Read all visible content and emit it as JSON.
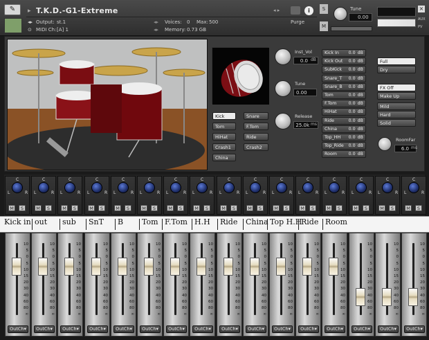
{
  "header": {
    "title": "T.K.D.-G1-Extreme",
    "output_label": "Output:",
    "output_value": "st.1",
    "voices_label": "Voices:",
    "voices_value": "0",
    "max_label": "Max:",
    "max_value": "500",
    "midi_label": "MIDI Ch:",
    "midi_value": "[A]  1",
    "memory_label": "Memory:",
    "memory_value": "0.73 GB",
    "purge_label": "Purge",
    "tune_label": "Tune",
    "tune_value": "0.00",
    "s_label": "S",
    "m_label": "M",
    "aux_label": "AUX",
    "pv_label": "PV"
  },
  "instrument": {
    "inst_vol_label": "Inst_Vol",
    "inst_vol_value": "0.0",
    "inst_vol_unit": "dB",
    "tune_label": "Tune",
    "tune_value": "0.00",
    "release_label": "Release",
    "release_value": "25.0k",
    "release_unit": "ms",
    "roomfar_label": "RoomFar",
    "roomfar_value": "6.0",
    "roomfar_unit": "ms"
  },
  "drum_buttons": [
    "Kick",
    "Snare",
    "Tom",
    "F.Tom",
    "HiHat",
    "Ride",
    "Crash1",
    "Crash2",
    "China"
  ],
  "selected_drum": "Kick",
  "levels": [
    {
      "name": "Kick In",
      "value": "0.0",
      "unit": "dB"
    },
    {
      "name": "Kick Out",
      "value": "0.0",
      "unit": "dB"
    },
    {
      "name": "SubKick",
      "value": "0.0",
      "unit": "dB"
    },
    {
      "name": "Snare_T",
      "value": "0.0",
      "unit": "dB"
    },
    {
      "name": "Snare_B",
      "value": "0.0",
      "unit": "dB"
    },
    {
      "name": "Tom",
      "value": "0.0",
      "unit": "dB"
    },
    {
      "name": "F.Tom",
      "value": "0.0",
      "unit": "dB"
    },
    {
      "name": "HiHat",
      "value": "0.0",
      "unit": "dB"
    },
    {
      "name": "Ride",
      "value": "0.0",
      "unit": "dB"
    },
    {
      "name": "China",
      "value": "0.0",
      "unit": "dB"
    },
    {
      "name": "Top_HH",
      "value": "0.0",
      "unit": "dB"
    },
    {
      "name": "Top_Ride",
      "value": "0.0",
      "unit": "dB"
    },
    {
      "name": "Room",
      "value": "0.0",
      "unit": "dB"
    }
  ],
  "mix_buttons": {
    "full": "Full",
    "dry": "Dry"
  },
  "fx_buttons": {
    "fx_off": "FX Off",
    "make_up": "Make Up",
    "mild": "Mild",
    "hard": "Hard",
    "solid": "Solid"
  },
  "channel_labels": [
    "Kick in",
    "out",
    "sub",
    "SnT",
    "B",
    "Tom",
    "F.Tom",
    "H.H",
    "Ride",
    "China",
    "Top H.H",
    "Ride",
    "Room"
  ],
  "pan_labels": {
    "c": "C",
    "l": "L",
    "r": "R"
  },
  "ms_labels": {
    "m": "M",
    "s": "S"
  },
  "fader_scale": [
    "10",
    "5",
    "0",
    "5",
    "10",
    "15",
    "20",
    "30",
    "40",
    "60",
    "80",
    "∞"
  ],
  "out_label": "OutCh▾"
}
